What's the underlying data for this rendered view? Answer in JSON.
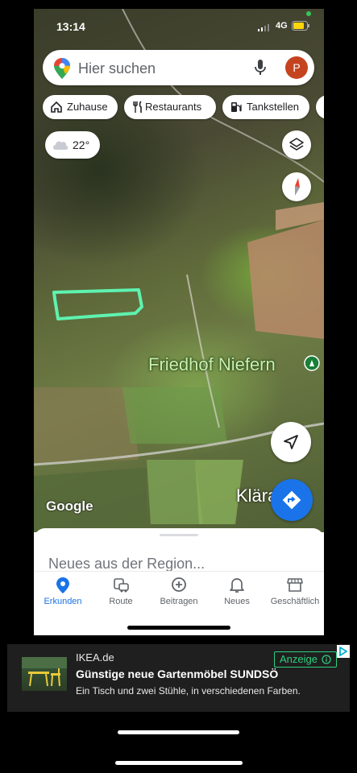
{
  "status_bar": {
    "time": "13:14",
    "network": "4G"
  },
  "search": {
    "placeholder": "Hier suchen",
    "avatar_initial": "P"
  },
  "chips": [
    {
      "label": "Zuhause",
      "icon": "home-icon"
    },
    {
      "label": "Restaurants",
      "icon": "fork-knife-icon"
    },
    {
      "label": "Tankstellen",
      "icon": "gas-station-icon"
    }
  ],
  "weather": {
    "temperature": "22°",
    "icon": "cloud-icon"
  },
  "map": {
    "poi_label": "Friedhof Niefern",
    "poi_label_partial": "Kläranlag",
    "attribution": "Google",
    "annotation_color": "#5ef2b0"
  },
  "sheet": {
    "title": "Neues aus der Region..."
  },
  "tabs": [
    {
      "label": "Erkunden",
      "icon": "location-pin-icon",
      "active": true
    },
    {
      "label": "Route",
      "icon": "car-transit-icon",
      "active": false
    },
    {
      "label": "Beitragen",
      "icon": "plus-circle-icon",
      "active": false
    },
    {
      "label": "Neues",
      "icon": "bell-icon",
      "active": false
    },
    {
      "label": "Geschäftlich",
      "icon": "storefront-icon",
      "active": false
    }
  ],
  "ad": {
    "source": "IKEA.de",
    "title": "Günstige neue Gartenmöbel SUNDSÖ",
    "description": "Ein Tisch und zwei Stühle, in verschiedenen Farben.",
    "badge": "Anzeige"
  },
  "colors": {
    "accent": "#1a73e8",
    "avatar": "#c5441f",
    "ad_badge": "#2bd17e"
  }
}
